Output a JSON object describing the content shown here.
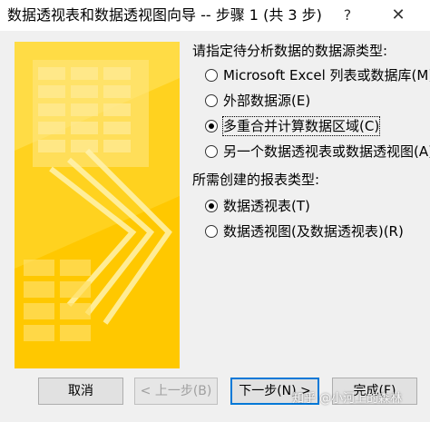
{
  "window": {
    "title": "数据透视表和数据透视图向导 -- 步骤 1 (共 3 步)",
    "help_glyph": "?",
    "close_glyph": "✕"
  },
  "data_source_group": {
    "label": "请指定待分析数据的数据源类型:",
    "options": [
      {
        "label": "Microsoft Excel 列表或数据库(M)",
        "selected": false
      },
      {
        "label": "外部数据源(E)",
        "selected": false
      },
      {
        "label": "多重合并计算数据区域(C)",
        "selected": true
      },
      {
        "label": "另一个数据透视表或数据透视图(A)",
        "selected": false
      }
    ]
  },
  "report_type_group": {
    "label": "所需创建的报表类型:",
    "options": [
      {
        "label": "数据透视表(T)",
        "selected": true
      },
      {
        "label": "数据透视图(及数据透视表)(R)",
        "selected": false
      }
    ]
  },
  "buttons": {
    "cancel": "取消",
    "back": "< 上一步(B)",
    "next": "下一步(N) >",
    "finish": "完成(F)"
  },
  "watermark": "知乎 @小河上的森林",
  "colors": {
    "banner_yellow": "#ffd21f",
    "banner_light": "#ffe680",
    "default_button_border": "#0078d7"
  }
}
